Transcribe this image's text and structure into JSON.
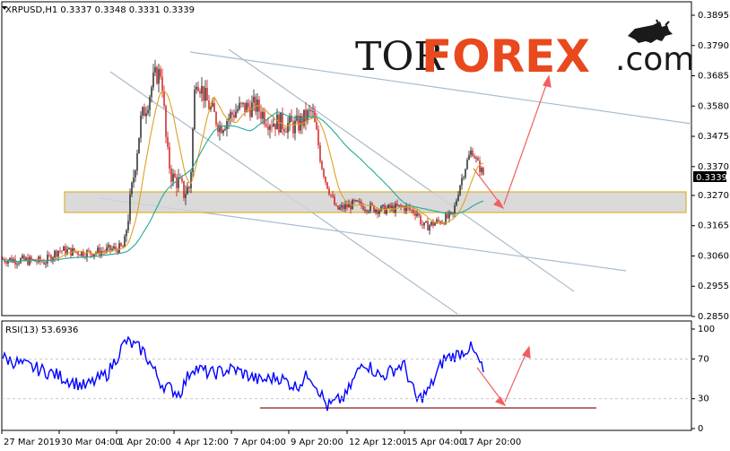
{
  "main_panel": {
    "header": "XRPUSD,H1  0.3337 0.3348 0.3331 0.3339",
    "current_price_label": "0.3339"
  },
  "rsi_panel": {
    "header": "RSI(13) 53.6936"
  },
  "logo": {
    "part1": "TOR",
    "part2": "FOREX",
    "part3": ".com"
  },
  "colors": {
    "candle_bull": "#1a1a1a",
    "candle_bear": "#cc1111",
    "ma_fast": "#e0a020",
    "ma_slow": "#20a89a",
    "channel_lines": "#a8bccd",
    "zone_fill": "#d3d3d3",
    "zone_border": "#e0b030",
    "arrows": "#f06060",
    "rsi_line": "#0000ff",
    "support_line": "#8b1a1a",
    "logo_orange": "#e8491d"
  },
  "chart_data": [
    {
      "type": "candlestick",
      "title": "XRPUSD,H1",
      "ohlc_last": {
        "open": 0.3337,
        "high": 0.3348,
        "low": 0.3331,
        "close": 0.3339
      },
      "y_ticks": [
        "0.3895",
        "0.3790",
        "0.3685",
        "0.3580",
        "0.3475",
        "0.3370",
        "0.3270",
        "0.3165",
        "0.3060",
        "0.2955",
        "0.2850"
      ],
      "x_ticks": [
        "27 Mar 2019",
        "30 Mar 04:00",
        "1 Apr 20:00",
        "4 Apr 12:00",
        "7 Apr 04:00",
        "9 Apr 20:00",
        "12 Apr 12:00",
        "15 Apr 04:00",
        "17 Apr 20:00"
      ],
      "ylim": [
        0.285,
        0.3895
      ],
      "price_path": [
        [
          0,
          0.305
        ],
        [
          50,
          0.304
        ],
        [
          65,
          0.308
        ],
        [
          100,
          0.307
        ],
        [
          138,
          0.309
        ],
        [
          147,
          0.329
        ],
        [
          157,
          0.353
        ],
        [
          165,
          0.36
        ],
        [
          172,
          0.368
        ],
        [
          180,
          0.37
        ],
        [
          186,
          0.342
        ],
        [
          192,
          0.333
        ],
        [
          198,
          0.332
        ],
        [
          205,
          0.328
        ],
        [
          212,
          0.33
        ],
        [
          218,
          0.369
        ],
        [
          230,
          0.36
        ],
        [
          245,
          0.351
        ],
        [
          265,
          0.357
        ],
        [
          285,
          0.358
        ],
        [
          300,
          0.353
        ],
        [
          330,
          0.351
        ],
        [
          348,
          0.356
        ],
        [
          356,
          0.343
        ],
        [
          362,
          0.333
        ],
        [
          375,
          0.322
        ],
        [
          395,
          0.324
        ],
        [
          425,
          0.322
        ],
        [
          450,
          0.323
        ],
        [
          465,
          0.321
        ],
        [
          472,
          0.316
        ],
        [
          490,
          0.318
        ],
        [
          505,
          0.32
        ],
        [
          512,
          0.33
        ],
        [
          520,
          0.338
        ],
        [
          526,
          0.343
        ],
        [
          534,
          0.337
        ],
        [
          540,
          0.3339
        ]
      ],
      "series": [
        {
          "values": "moving average (orange)"
        },
        {
          "values": "moving average (teal)"
        }
      ],
      "zone": [
        0.323,
        0.329
      ],
      "projection_arrows": [
        [
          0.337,
          0.3245
        ],
        [
          0.3245,
          0.366
        ]
      ]
    },
    {
      "type": "line",
      "title": "RSI(13) 53.6936",
      "y_ticks": [
        "100",
        "70",
        "30",
        "0"
      ],
      "ylim": [
        0,
        100
      ],
      "current": 53.6936,
      "rsi_path": [
        [
          0,
          72
        ],
        [
          30,
          63
        ],
        [
          60,
          55
        ],
        [
          95,
          42
        ],
        [
          120,
          55
        ],
        [
          140,
          88
        ],
        [
          160,
          78
        ],
        [
          180,
          45
        ],
        [
          200,
          35
        ],
        [
          215,
          62
        ],
        [
          235,
          55
        ],
        [
          260,
          60
        ],
        [
          290,
          48
        ],
        [
          310,
          52
        ],
        [
          330,
          42
        ],
        [
          345,
          55
        ],
        [
          355,
          40
        ],
        [
          365,
          22
        ],
        [
          385,
          32
        ],
        [
          405,
          68
        ],
        [
          425,
          52
        ],
        [
          450,
          65
        ],
        [
          465,
          28
        ],
        [
          478,
          38
        ],
        [
          495,
          70
        ],
        [
          512,
          75
        ],
        [
          524,
          82
        ],
        [
          534,
          68
        ],
        [
          540,
          53.7
        ]
      ],
      "support_level": 20,
      "projection_arrows": [
        [
          65,
          26
        ],
        [
          26,
          82
        ]
      ]
    }
  ]
}
